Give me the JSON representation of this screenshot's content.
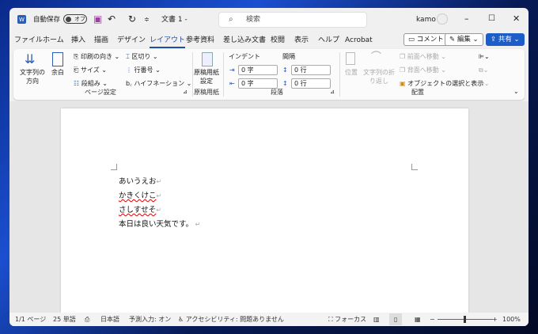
{
  "titlebar": {
    "autosave_label": "自動保存",
    "autosave_state": "オフ",
    "doc_title": "文書 1 -",
    "search_placeholder": "検索",
    "user": "kamo"
  },
  "tabs": [
    "ファイル",
    "ホーム",
    "挿入",
    "描画",
    "デザイン",
    "レイアウト",
    "参考資料",
    "差し込み文書",
    "校閲",
    "表示",
    "ヘルプ",
    "Acrobat"
  ],
  "active_tab": "レイアウト",
  "header_buttons": {
    "comment": "コメント",
    "edit": "編集",
    "share": "共有"
  },
  "ribbon": {
    "page_setup": {
      "label": "ページ設定",
      "text_direction": "文字列の\n方向",
      "margins": "余白",
      "orientation": "印刷の向き",
      "size": "サイズ",
      "columns": "段組み",
      "breaks": "区切り",
      "line_numbers": "行番号",
      "hyphenation": "ハイフネーション"
    },
    "genko": {
      "label": "原稿用紙",
      "button": "原稿用紙\n設定"
    },
    "paragraph": {
      "label": "段落",
      "indent_label": "インデント",
      "spacing_label": "間隔",
      "indent_left": "0 字",
      "indent_right": "0 字",
      "spacing_before": "0 行",
      "spacing_after": "0 行"
    },
    "arrange": {
      "label": "配置",
      "position": "位置",
      "wrap_text": "文字列の折\nり返し",
      "bring_forward": "前面へ移動",
      "send_backward": "背面へ移動",
      "selection_pane": "オブジェクトの選択と表示"
    }
  },
  "document": {
    "lines": [
      "あいうえお",
      "かきくけこ",
      "さしすせそ",
      "本日は良い天気です。"
    ]
  },
  "status": {
    "page": "1/1 ページ",
    "words": "25 単語",
    "language": "日本語",
    "predictive": "予測入力: オン",
    "accessibility": "アクセシビリティ: 問題ありません",
    "focus": "フォーカス",
    "zoom": "100%",
    "zoom_level": 100
  }
}
